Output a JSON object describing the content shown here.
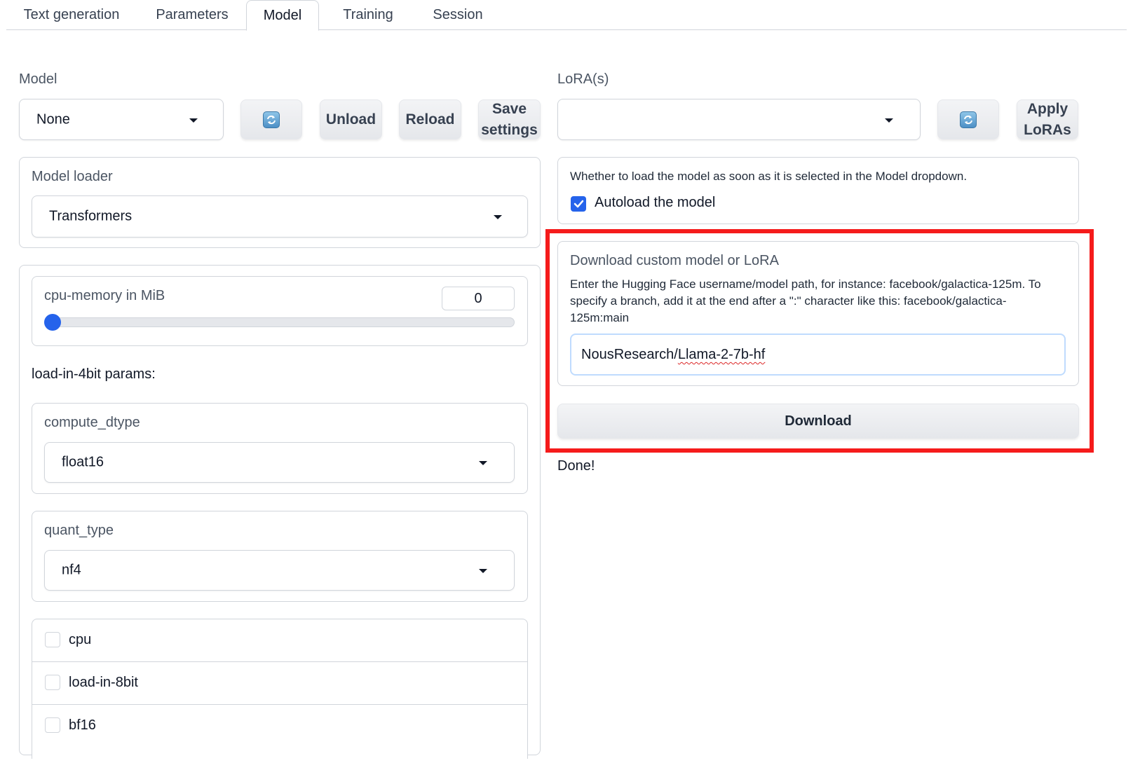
{
  "tabs": [
    {
      "label": "Text generation"
    },
    {
      "label": "Parameters"
    },
    {
      "label": "Model",
      "selected": true
    },
    {
      "label": "Training"
    },
    {
      "label": "Session"
    }
  ],
  "model": {
    "label": "Model",
    "selected": "None",
    "refresh_icon": "refresh-icon",
    "unload_label": "Unload",
    "reload_label": "Reload",
    "save_label_line1": "Save",
    "save_label_line2": "settings"
  },
  "model_loader": {
    "label": "Model loader",
    "selected": "Transformers"
  },
  "cpu_memory": {
    "label": "cpu-memory in MiB",
    "value": "0",
    "slider_fraction": 0
  },
  "load_4bit": {
    "heading": "load-in-4bit params:",
    "compute_dtype_label": "compute_dtype",
    "compute_dtype_value": "float16",
    "quant_type_label": "quant_type",
    "quant_type_value": "nf4"
  },
  "flags": [
    {
      "label": "cpu",
      "checked": false
    },
    {
      "label": "load-in-8bit",
      "checked": false
    },
    {
      "label": "bf16",
      "checked": false
    }
  ],
  "lora": {
    "label": "LoRA(s)",
    "selected": "",
    "apply_label_line1": "Apply",
    "apply_label_line2": "LoRAs"
  },
  "autoload": {
    "info": "Whether to load the model as soon as it is selected in the Model dropdown.",
    "label": "Autoload the model",
    "checked": true
  },
  "download": {
    "title": "Download custom model or LoRA",
    "desc_line1": "Enter the Hugging Face username/model path, for instance: facebook/galactica-125m. To",
    "desc_line2": "specify a branch, add it at the end after a \":\" character like this: facebook/galactica-",
    "desc_line3": "125m:main",
    "input_prefix": "NousResearch/",
    "input_suffix": "Llama-2-7b-hf",
    "button_label": "Download",
    "status": "Done!"
  },
  "colors": {
    "accent": "#2563eb",
    "highlight": "#f51b1b"
  }
}
